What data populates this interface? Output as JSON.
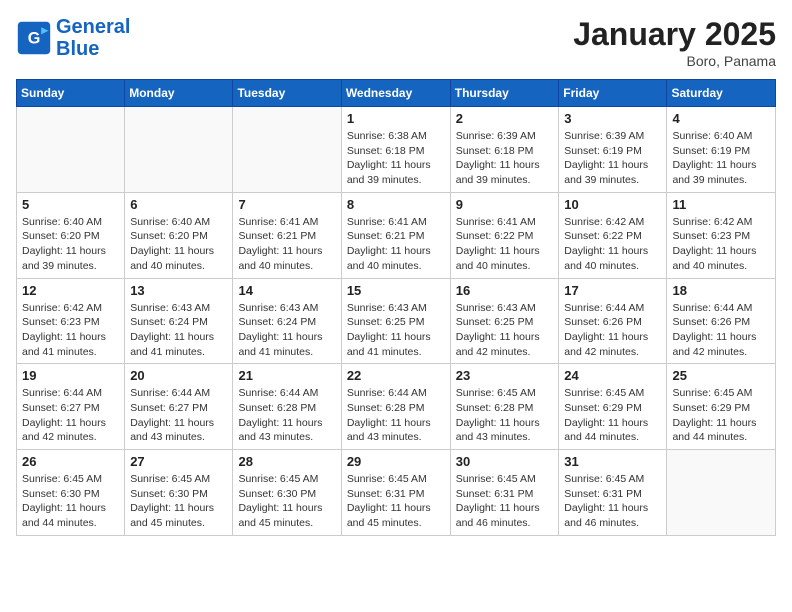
{
  "header": {
    "logo_line1": "General",
    "logo_line2": "Blue",
    "month": "January 2025",
    "location": "Boro, Panama"
  },
  "weekdays": [
    "Sunday",
    "Monday",
    "Tuesday",
    "Wednesday",
    "Thursday",
    "Friday",
    "Saturday"
  ],
  "weeks": [
    [
      {
        "day": "",
        "info": ""
      },
      {
        "day": "",
        "info": ""
      },
      {
        "day": "",
        "info": ""
      },
      {
        "day": "1",
        "info": "Sunrise: 6:38 AM\nSunset: 6:18 PM\nDaylight: 11 hours and 39 minutes."
      },
      {
        "day": "2",
        "info": "Sunrise: 6:39 AM\nSunset: 6:18 PM\nDaylight: 11 hours and 39 minutes."
      },
      {
        "day": "3",
        "info": "Sunrise: 6:39 AM\nSunset: 6:19 PM\nDaylight: 11 hours and 39 minutes."
      },
      {
        "day": "4",
        "info": "Sunrise: 6:40 AM\nSunset: 6:19 PM\nDaylight: 11 hours and 39 minutes."
      }
    ],
    [
      {
        "day": "5",
        "info": "Sunrise: 6:40 AM\nSunset: 6:20 PM\nDaylight: 11 hours and 39 minutes."
      },
      {
        "day": "6",
        "info": "Sunrise: 6:40 AM\nSunset: 6:20 PM\nDaylight: 11 hours and 40 minutes."
      },
      {
        "day": "7",
        "info": "Sunrise: 6:41 AM\nSunset: 6:21 PM\nDaylight: 11 hours and 40 minutes."
      },
      {
        "day": "8",
        "info": "Sunrise: 6:41 AM\nSunset: 6:21 PM\nDaylight: 11 hours and 40 minutes."
      },
      {
        "day": "9",
        "info": "Sunrise: 6:41 AM\nSunset: 6:22 PM\nDaylight: 11 hours and 40 minutes."
      },
      {
        "day": "10",
        "info": "Sunrise: 6:42 AM\nSunset: 6:22 PM\nDaylight: 11 hours and 40 minutes."
      },
      {
        "day": "11",
        "info": "Sunrise: 6:42 AM\nSunset: 6:23 PM\nDaylight: 11 hours and 40 minutes."
      }
    ],
    [
      {
        "day": "12",
        "info": "Sunrise: 6:42 AM\nSunset: 6:23 PM\nDaylight: 11 hours and 41 minutes."
      },
      {
        "day": "13",
        "info": "Sunrise: 6:43 AM\nSunset: 6:24 PM\nDaylight: 11 hours and 41 minutes."
      },
      {
        "day": "14",
        "info": "Sunrise: 6:43 AM\nSunset: 6:24 PM\nDaylight: 11 hours and 41 minutes."
      },
      {
        "day": "15",
        "info": "Sunrise: 6:43 AM\nSunset: 6:25 PM\nDaylight: 11 hours and 41 minutes."
      },
      {
        "day": "16",
        "info": "Sunrise: 6:43 AM\nSunset: 6:25 PM\nDaylight: 11 hours and 42 minutes."
      },
      {
        "day": "17",
        "info": "Sunrise: 6:44 AM\nSunset: 6:26 PM\nDaylight: 11 hours and 42 minutes."
      },
      {
        "day": "18",
        "info": "Sunrise: 6:44 AM\nSunset: 6:26 PM\nDaylight: 11 hours and 42 minutes."
      }
    ],
    [
      {
        "day": "19",
        "info": "Sunrise: 6:44 AM\nSunset: 6:27 PM\nDaylight: 11 hours and 42 minutes."
      },
      {
        "day": "20",
        "info": "Sunrise: 6:44 AM\nSunset: 6:27 PM\nDaylight: 11 hours and 43 minutes."
      },
      {
        "day": "21",
        "info": "Sunrise: 6:44 AM\nSunset: 6:28 PM\nDaylight: 11 hours and 43 minutes."
      },
      {
        "day": "22",
        "info": "Sunrise: 6:44 AM\nSunset: 6:28 PM\nDaylight: 11 hours and 43 minutes."
      },
      {
        "day": "23",
        "info": "Sunrise: 6:45 AM\nSunset: 6:28 PM\nDaylight: 11 hours and 43 minutes."
      },
      {
        "day": "24",
        "info": "Sunrise: 6:45 AM\nSunset: 6:29 PM\nDaylight: 11 hours and 44 minutes."
      },
      {
        "day": "25",
        "info": "Sunrise: 6:45 AM\nSunset: 6:29 PM\nDaylight: 11 hours and 44 minutes."
      }
    ],
    [
      {
        "day": "26",
        "info": "Sunrise: 6:45 AM\nSunset: 6:30 PM\nDaylight: 11 hours and 44 minutes."
      },
      {
        "day": "27",
        "info": "Sunrise: 6:45 AM\nSunset: 6:30 PM\nDaylight: 11 hours and 45 minutes."
      },
      {
        "day": "28",
        "info": "Sunrise: 6:45 AM\nSunset: 6:30 PM\nDaylight: 11 hours and 45 minutes."
      },
      {
        "day": "29",
        "info": "Sunrise: 6:45 AM\nSunset: 6:31 PM\nDaylight: 11 hours and 45 minutes."
      },
      {
        "day": "30",
        "info": "Sunrise: 6:45 AM\nSunset: 6:31 PM\nDaylight: 11 hours and 46 minutes."
      },
      {
        "day": "31",
        "info": "Sunrise: 6:45 AM\nSunset: 6:31 PM\nDaylight: 11 hours and 46 minutes."
      },
      {
        "day": "",
        "info": ""
      }
    ]
  ]
}
